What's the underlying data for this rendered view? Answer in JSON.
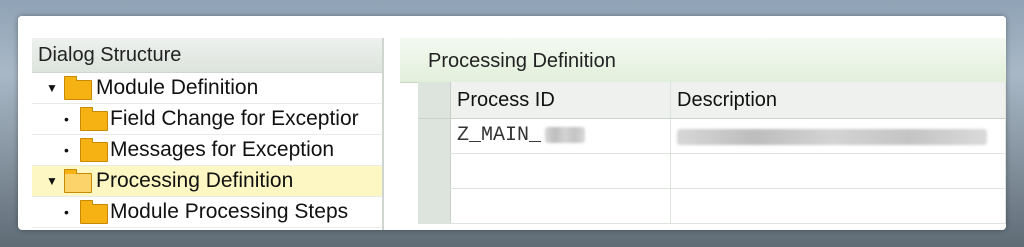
{
  "dialog_structure": {
    "title": "Dialog Structure",
    "items": [
      {
        "label": "Module Definition",
        "type": "expanded-folder"
      },
      {
        "label": "Field Change for Exceptior",
        "type": "child"
      },
      {
        "label": "Messages for Exception",
        "type": "child"
      },
      {
        "label": "Processing Definition",
        "type": "expanded-folder",
        "selected": true
      },
      {
        "label": "Module Processing Steps",
        "type": "child"
      }
    ]
  },
  "processing": {
    "title": "Processing Definition",
    "columns": [
      "Process ID",
      "Description"
    ],
    "rows": [
      {
        "process_id": "Z_MAIN_",
        "description": ""
      },
      {
        "process_id": "",
        "description": ""
      },
      {
        "process_id": "",
        "description": ""
      }
    ]
  },
  "colors": {
    "selected_row": "#fdf8c3",
    "folder": "#f6b213",
    "right_header": "#e2efdb"
  }
}
